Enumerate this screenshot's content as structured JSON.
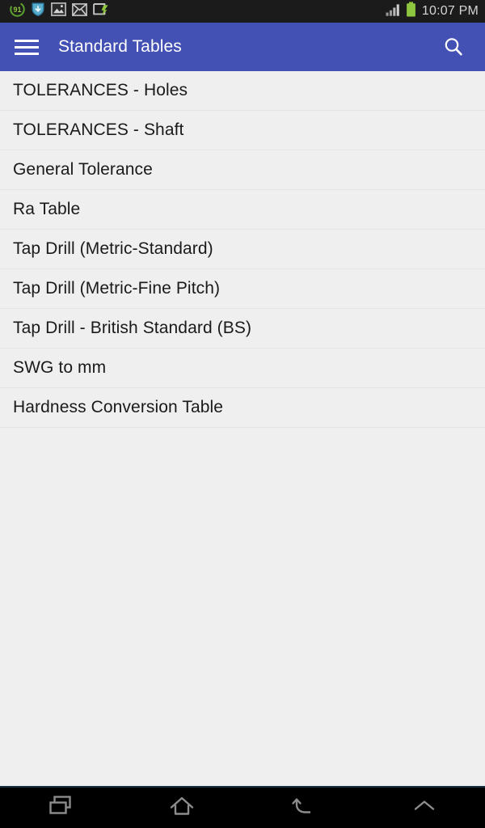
{
  "status_bar": {
    "icons": [
      {
        "name": "battery-saver-91-icon",
        "label": "91"
      },
      {
        "name": "download-shield-icon",
        "label": ""
      },
      {
        "name": "screenshot-image-icon",
        "label": ""
      },
      {
        "name": "mail-envelope-icon",
        "label": ""
      },
      {
        "name": "usb-transfer-icon",
        "label": ""
      }
    ],
    "signal_name": "signal-bars-icon",
    "battery_name": "battery-icon",
    "clock": "10:07 PM",
    "background_color": "#1b1b1b",
    "battery_color": "#8ec63f"
  },
  "app_bar": {
    "title": "Standard Tables",
    "menu_icon": "hamburger-menu-icon",
    "search_icon": "search-icon",
    "background_color": "#4350b4",
    "text_color": "#ffffff"
  },
  "list": {
    "background_color": "#efefef",
    "divider_color": "#e3e3e3",
    "items": [
      {
        "label": "TOLERANCES - Holes"
      },
      {
        "label": "TOLERANCES - Shaft"
      },
      {
        "label": "General Tolerance"
      },
      {
        "label": "Ra Table"
      },
      {
        "label": "Tap Drill (Metric-Standard)"
      },
      {
        "label": "Tap Drill (Metric-Fine Pitch)"
      },
      {
        "label": "Tap Drill - British Standard (BS)"
      },
      {
        "label": "SWG to mm"
      },
      {
        "label": "Hardness Conversion Table"
      }
    ]
  },
  "nav_bar": {
    "background_color": "#000000",
    "buttons": [
      {
        "name": "recent-apps-button",
        "icon": "recent-apps-icon"
      },
      {
        "name": "home-button",
        "icon": "home-icon"
      },
      {
        "name": "back-button",
        "icon": "back-arrow-icon"
      },
      {
        "name": "hide-navbar-button",
        "icon": "chevron-up-icon"
      }
    ]
  }
}
